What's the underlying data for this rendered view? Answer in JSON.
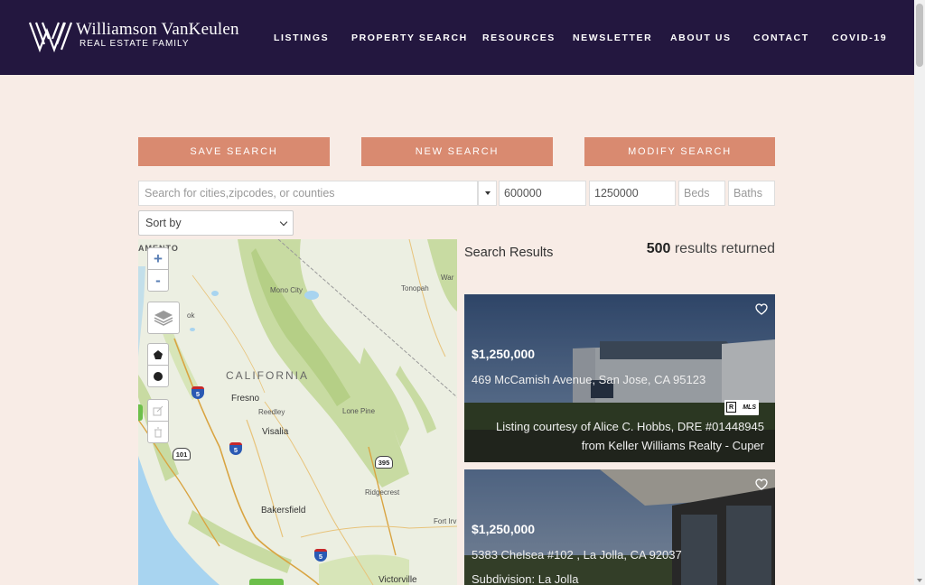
{
  "header": {
    "logo_name": "Williamson VanKeulen",
    "logo_sub": "REAL ESTATE FAMILY",
    "nav": [
      "LISTINGS",
      "PROPERTY SEARCH",
      "RESOURCES",
      "NEWSLETTER",
      "ABOUT US",
      "CONTACT",
      "COVID-19"
    ]
  },
  "actions": {
    "save": "SAVE SEARCH",
    "new": "NEW SEARCH",
    "modify": "MODIFY SEARCH"
  },
  "filters": {
    "location_placeholder": "Search for cities,zipcodes, or counties",
    "min_price": "600000",
    "max_price": "1250000",
    "beds_placeholder": "Beds",
    "baths_placeholder": "Baths",
    "sort_label": "Sort by"
  },
  "map": {
    "zoom_in": "+",
    "zoom_out": "-",
    "labels": {
      "sacramento": "AMENTO",
      "mono_city": "Mono City",
      "tonopah": "Tonopah",
      "california": "CALIFORNIA",
      "fresno": "Fresno",
      "reedley": "Reedley",
      "lone_pine": "Lone Pine",
      "visalia": "Visalia",
      "ridgecrest": "Ridgecrest",
      "bakersfield": "Bakersfield",
      "fort_irwin": "Fort Irv",
      "victorville": "Victorville",
      "war": "War",
      "wok": "ok"
    },
    "shields": {
      "i5_a": "5",
      "i5_b": "5",
      "i5_c": "5",
      "us101": "101",
      "us395": "395"
    }
  },
  "results": {
    "title": "Search Results",
    "count": "500",
    "count_suffix": " results returned",
    "listings": [
      {
        "price": "$1,250,000",
        "address": "469 McCamish Avenue, San Jose, CA 95123",
        "courtesy_line1": "Listing courtesy of Alice C. Hobbs, DRE #01448945",
        "courtesy_line2": "from Keller Williams Realty - Cuper",
        "mls_label": "MLS",
        "mls_r": "R"
      },
      {
        "price": "$1,250,000",
        "address": "5383 Chelsea #102 , La Jolla, CA 92037",
        "subdivision": "Subdivision: La Jolla"
      }
    ]
  },
  "colors": {
    "header_bg": "#23173f",
    "page_bg": "#f8ece6",
    "button_bg": "#d98a70"
  }
}
